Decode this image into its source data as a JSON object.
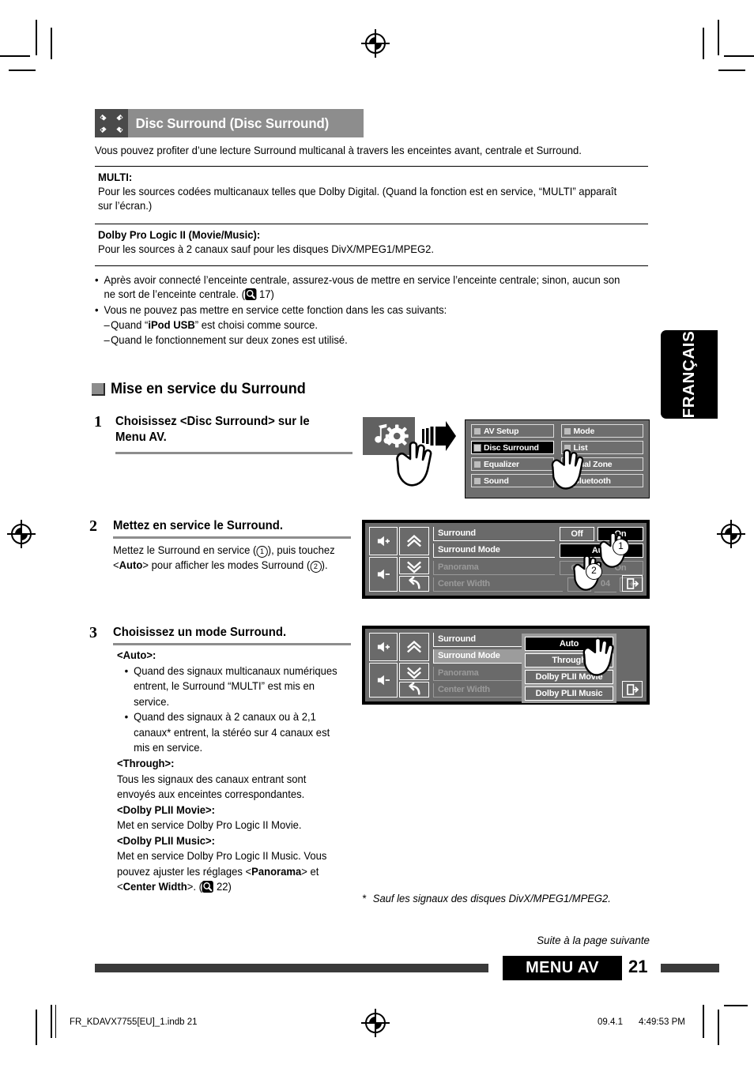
{
  "section": {
    "header_title": "Disc Surround (Disc Surround)",
    "header_icon": "speakers-icon",
    "intro": "Vous pouvez profiter d’une lecture Surround multicanal à travers les enceintes avant, centrale et Surround.",
    "blocks": [
      {
        "title": "MULTI:",
        "text": "Pour les sources codées multicanaux telles que Dolby Digital. (Quand la fonction est en service, “MULTI” apparaît sur l’écran.)"
      },
      {
        "title": "Dolby Pro Logic II (Movie/Music):",
        "text": "Pour les sources à 2 canaux sauf pour les disques DivX/MPEG1/MPEG2."
      }
    ],
    "notes": [
      {
        "marker": "•",
        "text_before": "Après avoir connecté l’enceinte centrale, assurez-vous de mettre en service l’enceinte centrale; sinon, aucun son ne sort de l’enceinte centrale. (",
        "page_ref": "17",
        "text_after": ")"
      },
      {
        "marker": "•",
        "text_before": "Vous ne pouvez pas mettre en service cette fonction dans les cas suivants:",
        "page_ref": "",
        "text_after": ""
      }
    ],
    "sub_notes": [
      {
        "marker": "–",
        "pre": "Quand “",
        "bold": "iPod USB",
        "post": "” est choisi comme source."
      },
      {
        "marker": "–",
        "pre": "Quand le fonctionnement sur deux zones est utilisé.",
        "bold": "",
        "post": ""
      }
    ]
  },
  "procedure": {
    "heading": "Mise en service du Surround",
    "heading_icon": "gray-square-icon",
    "steps": [
      {
        "number": "1",
        "title": "Choisissez <Disc Surround> sur le Menu AV.",
        "body": ""
      },
      {
        "number": "2",
        "title": "Mettez en service le Surround.",
        "body_line1_pre": "Mettez le Surround en service (",
        "body_line1_circ": "1",
        "body_line1_post": "), puis touchez",
        "body_line2_pre": "<",
        "body_line2_bold": "Auto",
        "body_line2_mid": "> pour afficher les modes Surround (",
        "body_line2_circ": "2",
        "body_line2_post": ")."
      },
      {
        "number": "3",
        "title": "Choisissez un mode Surround."
      }
    ]
  },
  "modes": [
    {
      "name": "<Auto>:",
      "bullets": [
        "Quand des signaux multicanaux numériques entrent, le Surround “MULTI” est mis en service.",
        "Quand des signaux à 2 canaux ou à 2,1 canaux* entrent, la stéréo sur 4 canaux est mis en service."
      ],
      "desc": ""
    },
    {
      "name": "<Through>:",
      "bullets": [],
      "desc": "Tous les signaux des canaux entrant sont envoyés aux enceintes correspondantes."
    },
    {
      "name": "<Dolby PLII Movie>:",
      "bullets": [],
      "desc": "Met en service Dolby Pro Logic II Movie."
    },
    {
      "name": "<Dolby PLII Music>:",
      "bullets": [],
      "desc_pre": "Met en service Dolby Pro Logic II Music. Vous pouvez ajuster les réglages <",
      "desc_b1": "Panorama",
      "desc_mid": "> et <",
      "desc_b2": "Center Width",
      "desc_post": ">. (",
      "page_ref": "22",
      "desc_end": ")"
    }
  ],
  "av_menu": {
    "icon_tile": "music-gear-icon",
    "arrow": "right-arrow-icon",
    "items": [
      {
        "label": "AV Setup",
        "icon": "av-setup-icon",
        "selected": false
      },
      {
        "label": "Mode",
        "icon": "mode-icon",
        "selected": false
      },
      {
        "label": "Disc Surround",
        "icon": "disc-surround-icon",
        "selected": true
      },
      {
        "label": "List",
        "icon": "list-icon",
        "selected": false
      },
      {
        "label": "Equalizer",
        "icon": "equalizer-icon",
        "selected": false
      },
      {
        "label": "Dual Zone",
        "icon": "dual-zone-icon",
        "selected": false
      },
      {
        "label": "Sound",
        "icon": "sound-icon",
        "selected": false
      },
      {
        "label": "Bluetooth",
        "icon": "bluetooth-icon",
        "selected": false
      }
    ]
  },
  "screen_step2": {
    "left_buttons": [
      "volume-up-icon",
      "scroll-up-icon",
      "scroll-down-icon",
      "volume-down-icon",
      "back-icon"
    ],
    "exit_button": "exit-icon",
    "rows": [
      {
        "label": "Surround",
        "dim": false,
        "highlight": false,
        "controls": [
          {
            "text": "Off",
            "state": "normal"
          },
          {
            "text": "On",
            "state": "on"
          }
        ]
      },
      {
        "label": "Surround Mode",
        "dim": false,
        "highlight": false,
        "controls": [
          {
            "text": "Auto",
            "state": "on-wide"
          }
        ]
      },
      {
        "label": "Panorama",
        "dim": true,
        "highlight": false,
        "controls": [
          {
            "text": "Off",
            "state": "dim"
          },
          {
            "text": "On",
            "state": "dim"
          }
        ]
      },
      {
        "label": "Center Width",
        "dim": true,
        "highlight": false,
        "controls": [
          {
            "text": "–",
            "state": "dim"
          },
          {
            "text": "04",
            "state": "value"
          },
          {
            "text": "+",
            "state": "dim"
          }
        ]
      }
    ],
    "callouts": [
      "1",
      "2"
    ]
  },
  "screen_step3": {
    "rows": [
      {
        "label": "Surround",
        "dim": false,
        "highlight": false
      },
      {
        "label": "Surround Mode",
        "dim": false,
        "highlight": true
      },
      {
        "label": "Panorama",
        "dim": true,
        "highlight": false
      },
      {
        "label": "Center Width",
        "dim": true,
        "highlight": false
      }
    ],
    "dropdown_options": [
      {
        "label": "Auto",
        "selected": true
      },
      {
        "label": "Through",
        "selected": false
      },
      {
        "label": "Dolby PLII Movie",
        "selected": false
      },
      {
        "label": "Dolby PLII Music",
        "selected": false
      }
    ],
    "exit_button": "exit-icon"
  },
  "footer": {
    "footnote_marker": "*",
    "footnote": "Sauf les signaux des disques DivX/MPEG1/MPEG2.",
    "continued": "Suite à la page suivante",
    "section_label": "MENU AV",
    "page_number": "21",
    "language_tab": "FRANÇAIS"
  },
  "doc_footer": {
    "filename": "FR_KDAVX7755[EU]_1.indb   21",
    "date": "09.4.1",
    "time": "4:49:53 PM"
  }
}
